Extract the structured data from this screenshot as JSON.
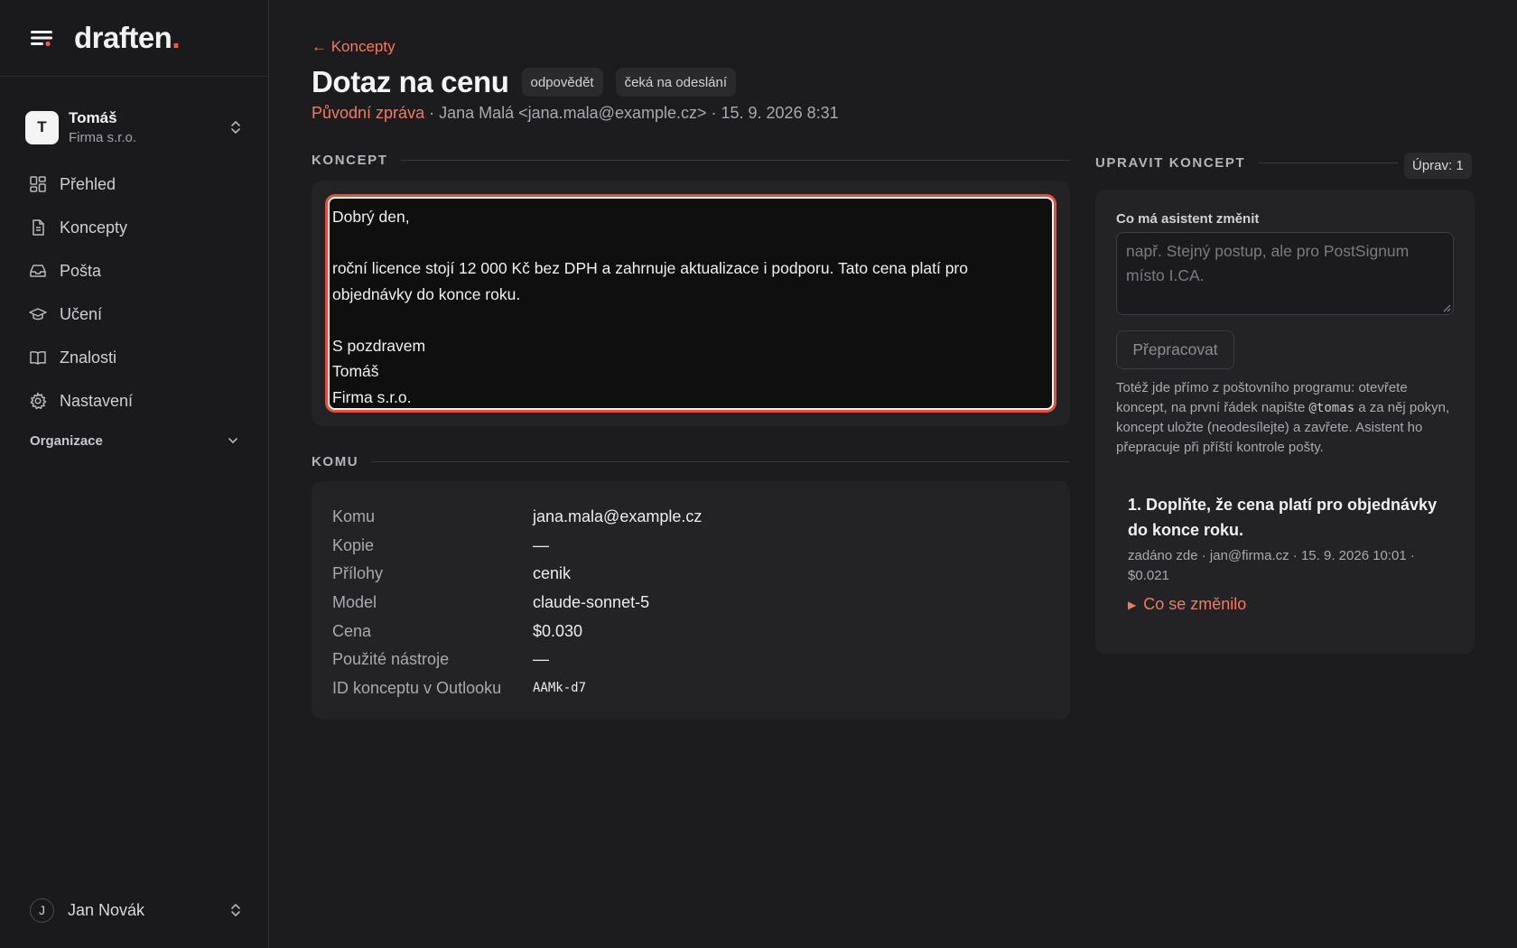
{
  "brand": {
    "name": "draften",
    "dot": "."
  },
  "account": {
    "initial": "T",
    "name": "Tomáš",
    "org": "Firma s.r.o."
  },
  "nav": [
    {
      "label": "Přehled",
      "icon": "dashboard-icon"
    },
    {
      "label": "Koncepty",
      "icon": "document-icon"
    },
    {
      "label": "Pošta",
      "icon": "inbox-icon"
    },
    {
      "label": "Učení",
      "icon": "graduation-cap-icon"
    },
    {
      "label": "Znalosti",
      "icon": "book-icon"
    },
    {
      "label": "Nastavení",
      "icon": "gear-icon"
    }
  ],
  "org_section": {
    "label": "Organizace"
  },
  "user": {
    "initial": "J",
    "name": "Jan Novák"
  },
  "header": {
    "back_label": "← Koncepty",
    "title": "Dotaz na cenu",
    "tags": [
      "odpovědět",
      "čeká na odeslání"
    ],
    "original_link": "Původní zpráva",
    "meta": " · Jana Malá <jana.mala@example.cz> · 15. 9. 2026 8:31"
  },
  "draft": {
    "section_label": "KONCEPT",
    "lines": [
      "Dobrý den,",
      "",
      "roční licence stojí 12 000 Kč bez DPH a zahrnuje aktualizace i podporu. Tato cena platí pro",
      "objednávky do konce roku.",
      "",
      "S pozdravem",
      "Tomáš",
      "Firma s.r.o."
    ]
  },
  "recipients": {
    "section_label": "KOMU",
    "rows": [
      {
        "key": "Komu",
        "value": "jana.mala@example.cz"
      },
      {
        "key": "Kopie",
        "value": "—"
      },
      {
        "key": "Přílohy",
        "value": "cenik"
      },
      {
        "key": "Model",
        "value": "claude-sonnet-5"
      },
      {
        "key": "Cena",
        "value": "$0.030"
      },
      {
        "key": "Použité nástroje",
        "value": "—"
      },
      {
        "key": "ID konceptu v Outlooku",
        "value": "AAMk-d7"
      }
    ]
  },
  "edit_panel": {
    "section_label": "UPRAVIT KONCEPT",
    "edits_badge": "Úprav: 1",
    "field_label": "Co má asistent změnit",
    "placeholder": "např. Stejný postup, ale pro PostSignum místo I.CA.",
    "button_label": "Přepracovat",
    "help_before": "Totéž jde přímo z poštovního programu: otevřete koncept, na první řádek napište ",
    "help_code": "@tomas",
    "help_after": " a za něj pokyn, koncept uložte (neodesílejte) a zavřete. Asistent ho přepracuje při příští kontrole pošty.",
    "history": [
      {
        "text": "1. Doplňte, že cena platí pro objednávky do konce roku.",
        "meta": "zadáno zde · jan@firma.cz · 15. 9. 2026 10:01 · $0.021",
        "toggle": "Co se změnilo"
      }
    ]
  }
}
